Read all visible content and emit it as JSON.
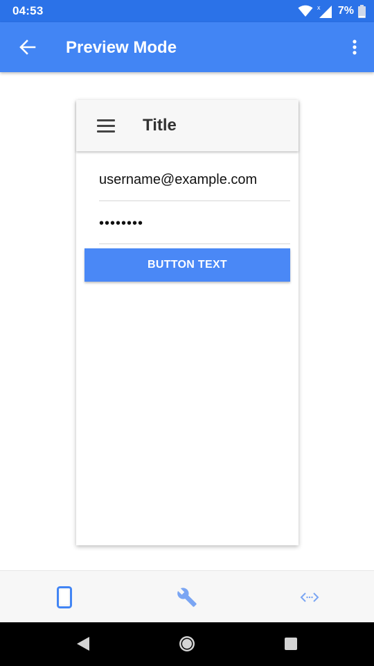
{
  "status_bar": {
    "time": "04:53",
    "battery_percent": "7%",
    "icons": [
      "wifi-icon",
      "signal-icon",
      "battery-icon"
    ]
  },
  "app_bar": {
    "title": "Preview Mode",
    "back_icon": "arrow-back-icon",
    "overflow_icon": "more-vert-icon",
    "color": "#4285f4"
  },
  "preview": {
    "toolbar_title": "Title",
    "menu_icon": "hamburger-menu-icon",
    "username_value": "username@example.com",
    "password_value": "••••••••",
    "button_label": "BUTTON TEXT",
    "button_color": "#4a88f6"
  },
  "bottom_nav": {
    "items": [
      {
        "icon": "phone-device-icon",
        "active": true
      },
      {
        "icon": "wrench-icon",
        "active": false
      },
      {
        "icon": "code-brackets-icon",
        "active": false
      }
    ],
    "active_color": "#4285f4"
  },
  "system_nav": {
    "items": [
      "back-triangle-icon",
      "home-circle-icon",
      "recents-square-icon"
    ]
  }
}
